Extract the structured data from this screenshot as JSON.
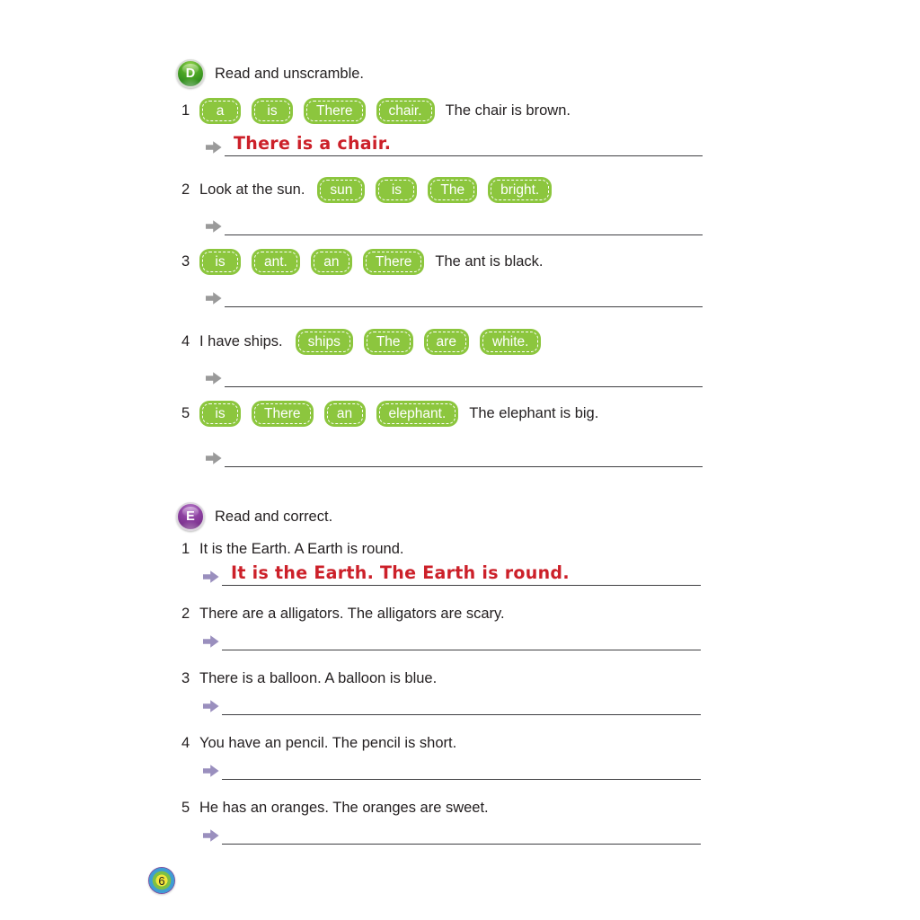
{
  "page": {
    "number": "6"
  },
  "sections": [
    {
      "letter": "D",
      "color": "#49a324",
      "title": "Read and unscramble.",
      "arrow_color": "#9a9a9a",
      "items": [
        {
          "number": "1",
          "lead_text": "",
          "tiles": [
            "a",
            "is",
            "There",
            "chair."
          ],
          "trail_text": "The chair is brown.",
          "answer": "There is a chair."
        },
        {
          "number": "2",
          "lead_text": "Look at the sun.",
          "tiles": [
            "sun",
            "is",
            "The",
            "bright."
          ],
          "trail_text": "",
          "answer": ""
        },
        {
          "number": "3",
          "lead_text": "",
          "tiles": [
            "is",
            "ant.",
            "an",
            "There"
          ],
          "trail_text": "The ant is black.",
          "answer": ""
        },
        {
          "number": "4",
          "lead_text": "I have ships.",
          "tiles": [
            "ships",
            "The",
            "are",
            "white."
          ],
          "trail_text": "",
          "answer": ""
        },
        {
          "number": "5",
          "lead_text": "",
          "tiles": [
            "is",
            "There",
            "an",
            "elephant."
          ],
          "trail_text": "The elephant is big.",
          "answer": ""
        }
      ]
    },
    {
      "letter": "E",
      "color": "#8a3d9e",
      "title": "Read and correct.",
      "arrow_color": "#9a8fbe",
      "items": [
        {
          "number": "1",
          "sentence": "It is the Earth. A Earth is round.",
          "answer": "It is the Earth. The Earth is round."
        },
        {
          "number": "2",
          "sentence": "There are a alligators. The alligators are scary.",
          "answer": ""
        },
        {
          "number": "3",
          "sentence": "There is a balloon. A balloon is blue.",
          "answer": ""
        },
        {
          "number": "4",
          "sentence": "You have an pencil. The pencil is short.",
          "answer": ""
        },
        {
          "number": "5",
          "sentence": "He has an oranges. The oranges are sweet.",
          "answer": ""
        }
      ]
    }
  ],
  "tile_color": "#8cc63e",
  "answer_text_color": "#cc2029"
}
